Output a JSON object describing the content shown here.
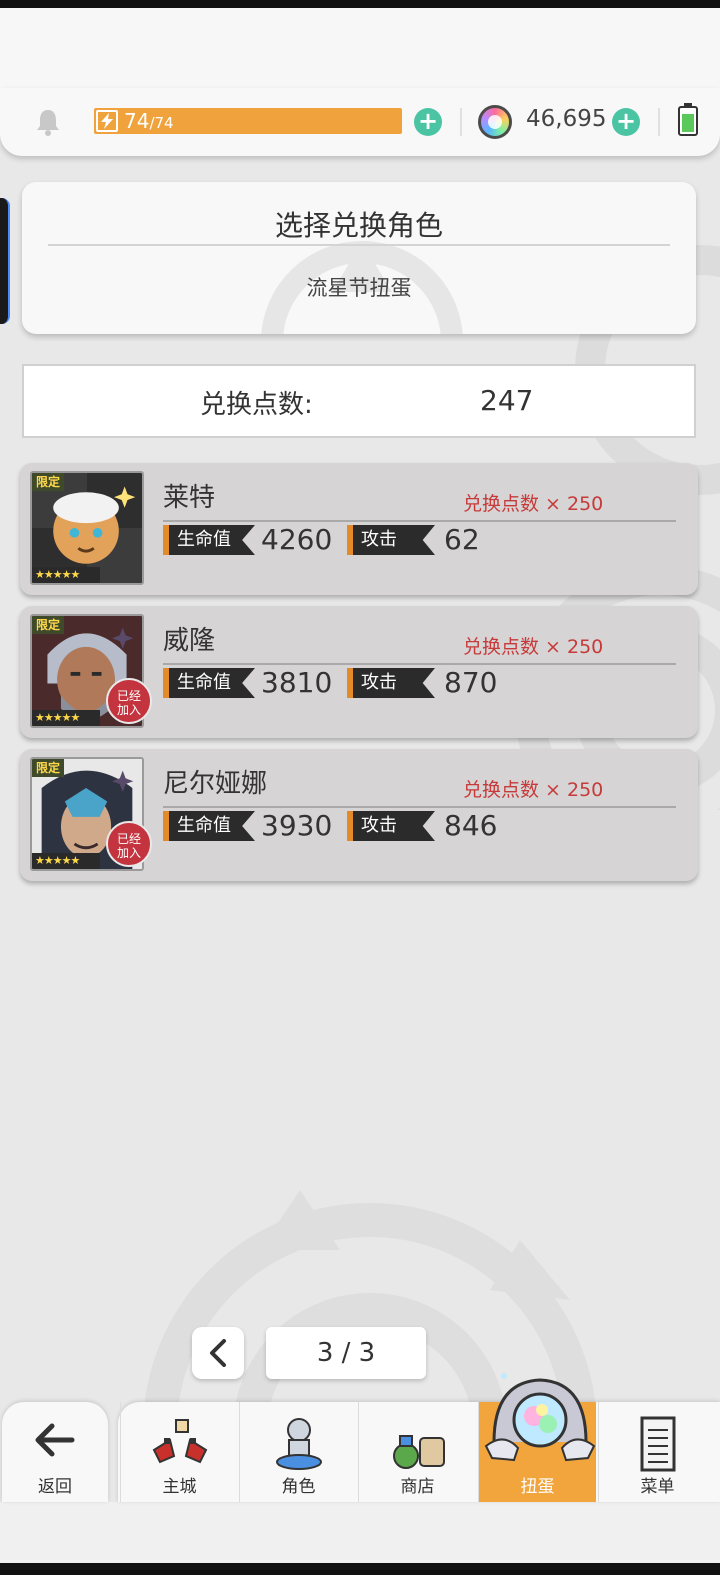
{
  "status_bar": {
    "energy_current": "74",
    "energy_max": "/74",
    "energy_fraction": 1.0,
    "gems": "46,695",
    "colors": {
      "energy": "#f0a33c",
      "plus": "#4bc4a4"
    }
  },
  "header": {
    "title": "选择兑换角色",
    "subtitle": "流星节扭蛋"
  },
  "points": {
    "label": "兑换点数:",
    "value": "247"
  },
  "characters": [
    {
      "name": "莱特",
      "cost": "兑换点数 × 250",
      "hp_label": "生命值",
      "hp": "4260",
      "atk_label": "攻击",
      "atk": "62",
      "limited": "限定",
      "stars": "★★★★★",
      "joined": ""
    },
    {
      "name": "威隆",
      "cost": "兑换点数 × 250",
      "hp_label": "生命值",
      "hp": "3810",
      "atk_label": "攻击",
      "atk": "870",
      "limited": "限定",
      "stars": "★★★★★",
      "joined": "已经加入"
    },
    {
      "name": "尼尔娅娜",
      "cost": "兑换点数 × 250",
      "hp_label": "生命值",
      "hp": "3930",
      "atk_label": "攻击",
      "atk": "846",
      "limited": "限定",
      "stars": "★★★★★",
      "joined": "已经加入"
    }
  ],
  "pager": {
    "page": "3 / 3"
  },
  "nav": {
    "back": "返回",
    "items": [
      {
        "label": "主城",
        "icon": "town-icon"
      },
      {
        "label": "角色",
        "icon": "character-icon"
      },
      {
        "label": "商店",
        "icon": "shop-icon"
      },
      {
        "label": "扭蛋",
        "icon": "gacha-icon"
      },
      {
        "label": "菜单",
        "icon": "menu-icon"
      }
    ],
    "active_color": "#f2a53d"
  }
}
